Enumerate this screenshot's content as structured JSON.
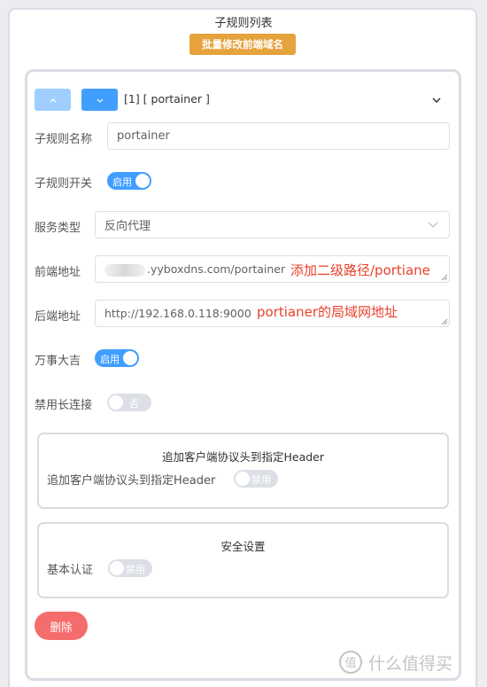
{
  "header": {
    "title": "子规则列表",
    "batch_button": "批量修改前端域名"
  },
  "rule": {
    "title": "[1] [ portainer ]",
    "fields": {
      "name_label": "子规则名称",
      "name_value": "portainer",
      "switch_label": "子规则开关",
      "switch_state": "启用",
      "service_type_label": "服务类型",
      "service_type_value": "反向代理",
      "frontend_label": "前端地址",
      "frontend_value": ".yyboxdns.com/portainer",
      "backend_label": "后端地址",
      "backend_value": "http://192.168.0.118:9000",
      "lucky_label": "万事大吉",
      "lucky_state": "启用",
      "keepalive_label": "禁用长连接",
      "keepalive_state": "否"
    },
    "client_header": {
      "title": "追加客户端协议头到指定Header",
      "label": "追加客户端协议头到指定Header",
      "state": "禁用"
    },
    "security": {
      "title": "安全设置",
      "basic_auth_label": "基本认证",
      "basic_auth_state": "禁用"
    },
    "delete_button": "删除"
  },
  "annotations": {
    "frontend_note": "添加二级路径/portiane",
    "backend_note": "portianer的局域网地址"
  },
  "watermark": {
    "text": "什么值得买"
  },
  "colors": {
    "primary": "#409eff",
    "primary_light": "#a0cfff",
    "warning": "#e6a23c",
    "danger": "#f56c6c",
    "annotation": "#e8412c",
    "switch_off": "#dcdfe6"
  }
}
